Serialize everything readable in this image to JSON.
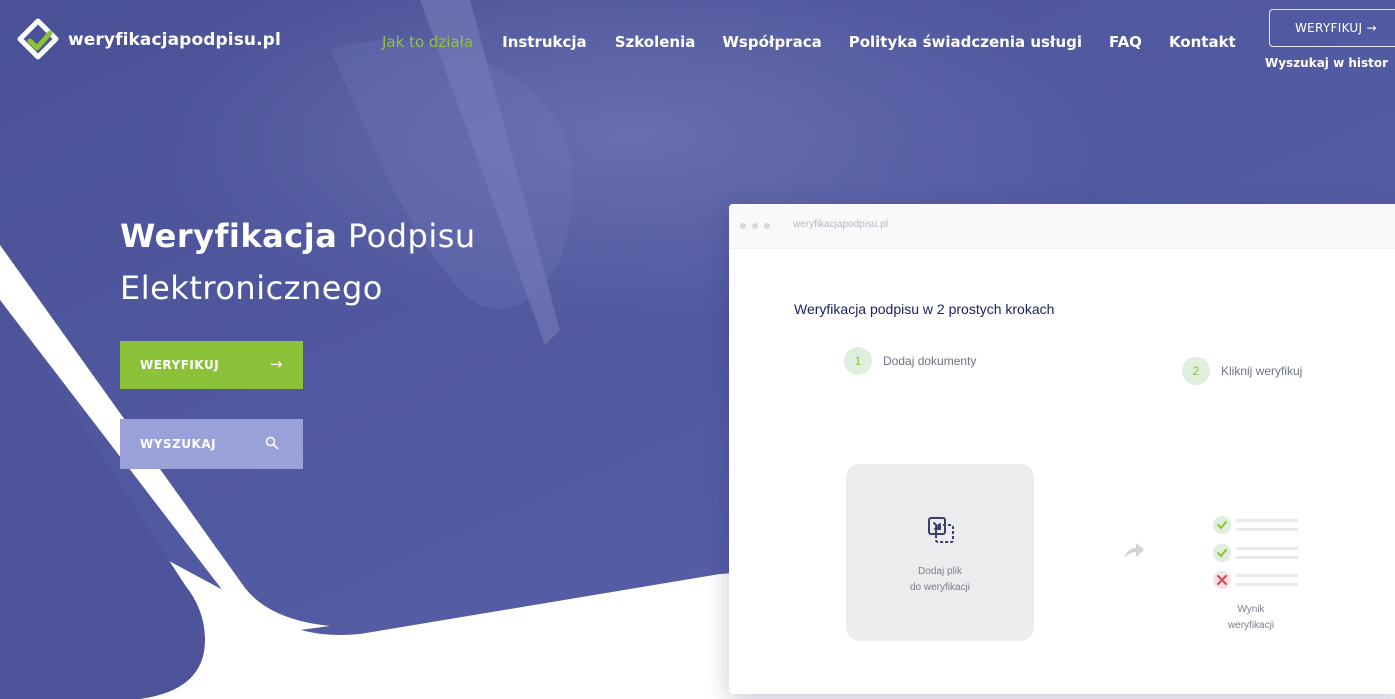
{
  "brand": {
    "name": "weryfikacjapodpisu.pl"
  },
  "nav": {
    "items": [
      {
        "label": "Jak to działa",
        "active": true
      },
      {
        "label": "Instrukcja"
      },
      {
        "label": "Szkolenia"
      },
      {
        "label": "Współpraca"
      },
      {
        "label": "Polityka świadczenia usługi"
      },
      {
        "label": "FAQ"
      },
      {
        "label": "Kontakt"
      }
    ]
  },
  "header": {
    "verify_button": "WERYFIKUJ →",
    "history_link": "Wyszukaj w histor"
  },
  "hero": {
    "title_bold": "Weryfikacja",
    "title_rest_line1": "Podpisu",
    "title_line2": "Elektronicznego",
    "verify_button": "WERYFIKUJ",
    "verify_arrow": "→",
    "search_button": "WYSZUKAJ"
  },
  "mockup": {
    "url": "weryfikacjapodpisu.pl",
    "heading": "Weryfikacja podpisu w 2 prostych krokach",
    "steps": [
      {
        "number": "1",
        "label": "Dodaj dokumenty"
      },
      {
        "number": "2",
        "label": "Kliknij weryfikuj"
      }
    ],
    "dropzone_text": "Dodaj plik\ndo weryfikacji",
    "result_text": "Wynik\nweryfikacji"
  },
  "colors": {
    "hero_blue": "#4d549a",
    "accent_green": "#8bc23a",
    "search_lilac": "#9aa1d9",
    "mock_heading_navy": "#1d2361"
  },
  "icons": [
    "logo-mark-icon",
    "search-icon",
    "file-drop-icon",
    "arrow-right-icon",
    "checklist-result-icon"
  ]
}
